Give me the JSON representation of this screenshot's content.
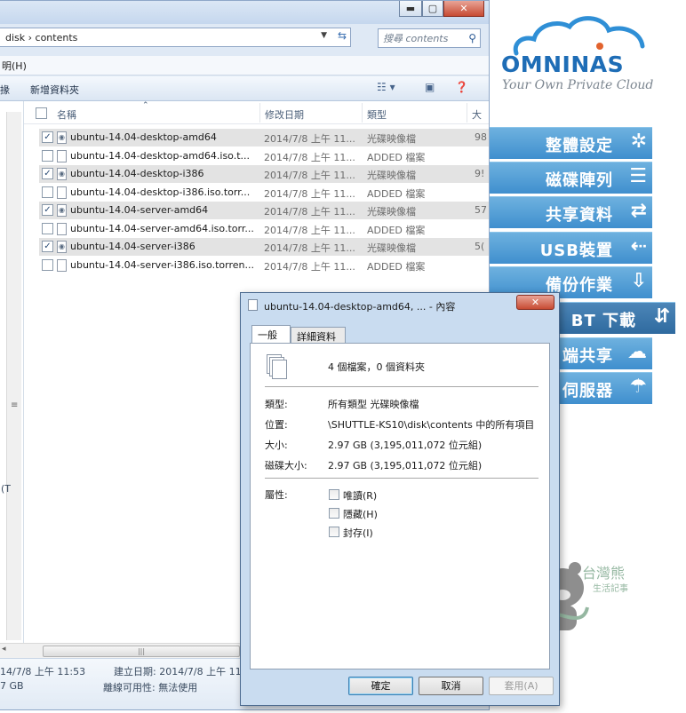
{
  "explorer": {
    "window_buttons": {
      "minimize": "▬",
      "maximize": "▢",
      "close": "✕"
    },
    "address": {
      "path": "disk  ›  contents"
    },
    "search": {
      "placeholder": "搜尋 contents"
    },
    "menu": {
      "item": "明(H)"
    },
    "toolbar": {
      "left_fragment": "掾",
      "new_folder": "新增資料夾"
    },
    "columns": {
      "name": "名稱",
      "modified": "修改日期",
      "type": "類型",
      "size": "大"
    },
    "files": [
      {
        "name": "ubuntu-14.04-desktop-amd64",
        "date": "2014/7/8 上午 11...",
        "type": "光碟映像檔",
        "size": "98",
        "checked": true,
        "selected": true
      },
      {
        "name": "ubuntu-14.04-desktop-amd64.iso.t...",
        "date": "2014/7/8 上午 11...",
        "type": "ADDED 檔案",
        "size": "",
        "checked": false,
        "selected": false
      },
      {
        "name": "ubuntu-14.04-desktop-i386",
        "date": "2014/7/8 上午 11...",
        "type": "光碟映像檔",
        "size": "9!",
        "checked": true,
        "selected": true
      },
      {
        "name": "ubuntu-14.04-desktop-i386.iso.torr...",
        "date": "2014/7/8 上午 11...",
        "type": "ADDED 檔案",
        "size": "",
        "checked": false,
        "selected": false
      },
      {
        "name": "ubuntu-14.04-server-amd64",
        "date": "2014/7/8 上午 11...",
        "type": "光碟映像檔",
        "size": "57",
        "checked": true,
        "selected": true
      },
      {
        "name": "ubuntu-14.04-server-amd64.iso.torr...",
        "date": "2014/7/8 上午 11...",
        "type": "ADDED 檔案",
        "size": "",
        "checked": false,
        "selected": false
      },
      {
        "name": "ubuntu-14.04-server-i386",
        "date": "2014/7/8 上午 11...",
        "type": "光碟映像檔",
        "size": "5(",
        "checked": true,
        "selected": true
      },
      {
        "name": "ubuntu-14.04-server-i386.iso.torren...",
        "date": "2014/7/8 上午 11...",
        "type": "ADDED 檔案",
        "size": "",
        "checked": false,
        "selected": false
      }
    ],
    "details": {
      "modified_fragment": "14/7/8 上午 11:53",
      "size_fragment": "7 GB",
      "created": "建立日期: 2014/7/8 上午 11:5",
      "offline": "離線可用性: 無法使用",
      "nav_fragment": "(T"
    }
  },
  "omninas": {
    "logo": "OMNINAS",
    "tagline": "Your Own Private Cloud",
    "menu": [
      {
        "label": "整體設定",
        "icon": "✲"
      },
      {
        "label": "磁碟陣列",
        "icon": "☰"
      },
      {
        "label": "共享資料",
        "icon": "⇄"
      },
      {
        "label": "USB裝置",
        "icon": "⇠"
      },
      {
        "label": "備份作業",
        "icon": "⇩"
      },
      {
        "label": "BT 下載",
        "icon": "⇵"
      },
      {
        "label": "端共享",
        "icon": "☁"
      },
      {
        "label": "伺服器",
        "icon": "☂"
      }
    ],
    "watermark": {
      "title": "台灣熊",
      "subtitle": "生活記事"
    }
  },
  "dialog": {
    "title": "ubuntu-14.04-desktop-amd64, ... - 內容",
    "close": "✕",
    "tabs": [
      "一般",
      "詳細資料"
    ],
    "summary": "4 個檔案，0 個資料夾",
    "properties": [
      {
        "label": "類型:",
        "value": "所有類型 光碟映像檔"
      },
      {
        "label": "位置:",
        "value": "\\SHUTTLE-KS10\\disk\\contents 中的所有項目"
      },
      {
        "label": "大小:",
        "value": "2.97 GB (3,195,011,072 位元組)"
      },
      {
        "label": "磁碟大小:",
        "value": "2.97 GB (3,195,011,072 位元組)"
      }
    ],
    "attributes_label": "屬性:",
    "attributes": [
      "唯讀(R)",
      "隱藏(H)",
      "封存(I)"
    ],
    "buttons": {
      "ok": "確定",
      "cancel": "取消",
      "apply": "套用(A)"
    }
  }
}
